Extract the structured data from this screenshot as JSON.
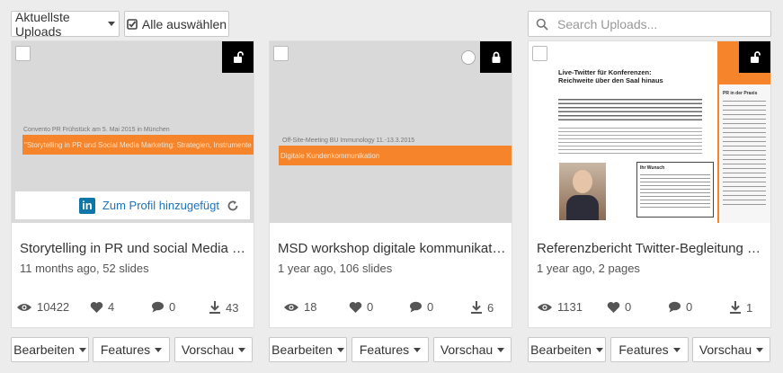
{
  "toolbar": {
    "sort_label": "Aktuellste Uploads",
    "select_all_label": "Alle auswählen",
    "search_placeholder": "Search Uploads..."
  },
  "cards": [
    {
      "slide": {
        "small_text": "Convento PR Frühstück am 5. Mai 2015 in München",
        "band_text": "\"Storytelling in PR und Social Media Marketing: Strategien, Instrumente und B"
      },
      "title": "Storytelling in PR und social Media M…",
      "meta": "11 months ago, 52 slides",
      "views": "10422",
      "likes": "4",
      "comments": "0",
      "downloads": "43",
      "linkedin_text": "Zum Profil hinzugefügt",
      "locked": false
    },
    {
      "slide": {
        "small_text": "Off-Site-Meeting BU Immunology 11.-13.3.2015",
        "band_text": "Digitale Kundenkommunikation"
      },
      "title": "MSD workshop digitale kommunikatio…",
      "meta": "1 year ago, 106 slides",
      "views": "18",
      "likes": "0",
      "comments": "0",
      "downloads": "6",
      "locked": true
    },
    {
      "slide": {
        "headline1": "Live-Twitter für Konferenzen:",
        "headline2": "Reichweite über den Saal hinaus",
        "sidebar_title": "PR in der Praxis",
        "box_title": "Ihr Wunsch"
      },
      "title": "Referenzbericht Twitter-Begleitung au…",
      "meta": "1 year ago, 2 pages",
      "views": "1131",
      "likes": "0",
      "comments": "0",
      "downloads": "1",
      "locked": false
    }
  ],
  "actions": {
    "edit_label": "Bearbeiten",
    "features_label": "Features",
    "preview_label": "Vorschau"
  },
  "colors": {
    "accent": "#f5842a",
    "linkedin": "#0e76a8"
  }
}
